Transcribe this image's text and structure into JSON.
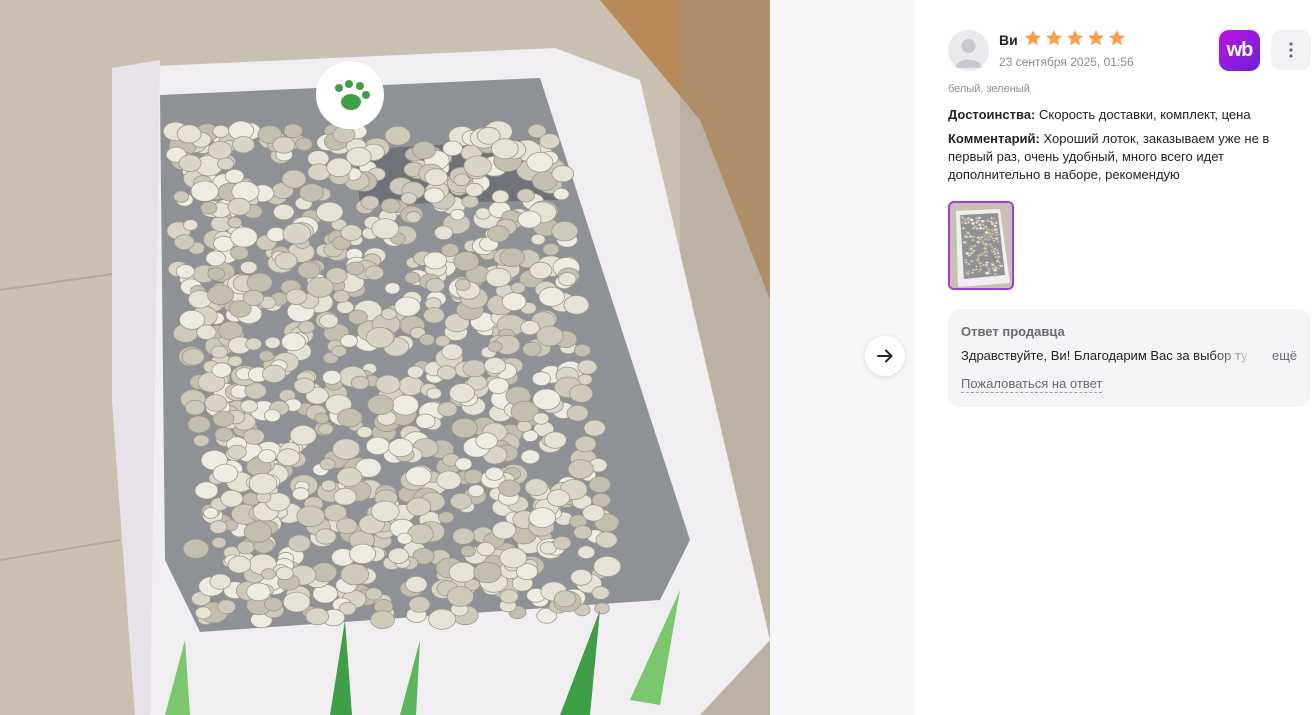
{
  "review": {
    "author": "Ви",
    "rating": 5,
    "rating_max": 5,
    "date": "23 сентября 2025, 01:56",
    "variant": "белый, зеленый",
    "pros_label": "Достоинства:",
    "pros_text": "Скорость доставки, комплект, цена",
    "comment_label": "Комментарий:",
    "comment_text": "Хороший лоток, заказываем уже не в первый раз, очень удобный, много всего идет дополнительно в наборе, рекомендую"
  },
  "brand": {
    "logo_text": "wb",
    "accent": "#a33be6",
    "star_color": "#ff9e45"
  },
  "photos": {
    "count": 1,
    "selected": 1
  },
  "seller_answer": {
    "title": "Ответ продавца",
    "text": "Здравствуйте, Ви! Благодарим Вас за выбор ту",
    "more": "ещё",
    "complain": "Пожаловаться на ответ"
  },
  "icons": {
    "next": "arrow-right-icon",
    "menu": "more-vertical-icon",
    "avatar": "user-avatar-icon",
    "star": "star-icon"
  }
}
